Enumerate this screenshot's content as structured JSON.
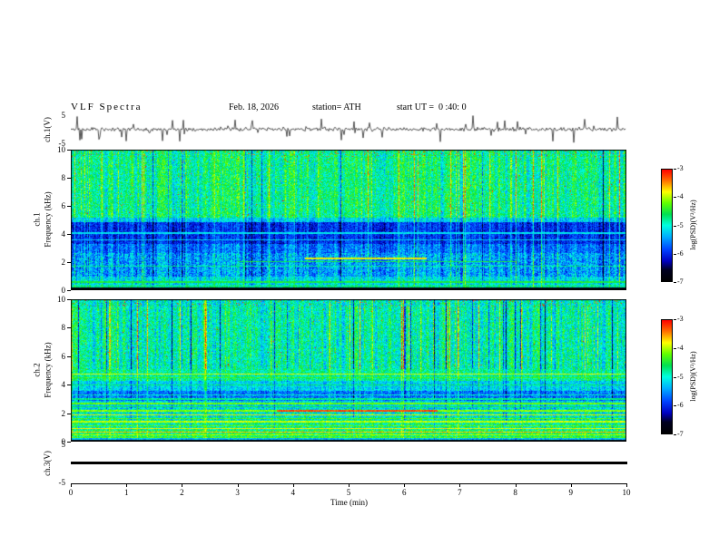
{
  "header": {
    "title": "VLF Spectra",
    "date": "Feb. 18, 2026",
    "station": "station= ATH",
    "start_ut": "start UT =  0 :40: 0"
  },
  "axes": {
    "x": {
      "label": "Time (min)",
      "range": [
        0,
        10
      ],
      "ticks": [
        0,
        1,
        2,
        3,
        4,
        5,
        6,
        7,
        8,
        9,
        10
      ]
    },
    "wave_y": {
      "units": "V",
      "range": [
        -5,
        5
      ],
      "ticks": [
        5,
        -5
      ]
    },
    "spec_y": {
      "label": "Frequency (kHz)",
      "range": [
        0,
        10
      ],
      "ticks": [
        10,
        8,
        6,
        4,
        2,
        0
      ]
    },
    "colorbar": {
      "label": "log(PSD)(V²/Hz)",
      "range": [
        -7,
        -3
      ],
      "ticks": [
        -3,
        -4,
        -5,
        -6,
        -7
      ]
    }
  },
  "panels": {
    "ch1_wave": {
      "label": "ch.1(V)"
    },
    "ch1_spec": {
      "line1": "ch.1",
      "line2": "Frequency (kHz)"
    },
    "ch2_spec": {
      "line1": "ch.2",
      "line2": "Frequency (kHz)"
    },
    "ch3_wave": {
      "label": "ch.3(V)"
    }
  },
  "colormap": [
    [
      0,
      "#000000"
    ],
    [
      0.1,
      "#000020"
    ],
    [
      0.18,
      "#0000c0"
    ],
    [
      0.28,
      "#0040ff"
    ],
    [
      0.4,
      "#00b0ff"
    ],
    [
      0.5,
      "#00ffe0"
    ],
    [
      0.6,
      "#00e050"
    ],
    [
      0.7,
      "#60ff00"
    ],
    [
      0.8,
      "#ffff00"
    ],
    [
      0.9,
      "#ff7000"
    ],
    [
      1,
      "#ff0000"
    ]
  ],
  "chart_data": [
    {
      "type": "line",
      "name": "ch1-voltage-time-series",
      "ylabel": "ch.1(V)",
      "ylim": [
        -5,
        5
      ],
      "xlim": [
        0,
        10
      ],
      "xlabel": "Time (min)",
      "description": "Channel-1 VLF receiver voltage vs time: continuous low-amplitude noise around 0 V punctuated by frequent impulsive sferic spikes reaching toward ±5 V across the full 10-minute record.",
      "render": {
        "seed": 11,
        "sigma": 0.3,
        "spike_prob": 0.08,
        "spike_extra": 3.6
      }
    },
    {
      "type": "heatmap",
      "name": "ch1-spectrogram",
      "ylabel": "Frequency (kHz)",
      "ylim": [
        0,
        10
      ],
      "xlim": [
        0,
        10
      ],
      "zlabel": "log(PSD)(V²/Hz)",
      "zlim": [
        -7,
        -3
      ],
      "description": "Channel-1 dynamic spectrum 0-10 kHz over 10 min: green/cyan broadband power above ~5 kHz with dense vertical sferic striations (occasional yellow/red flecks, red speckle along the top edge), a dark-blue low-power band ~3.3-4.9 kHz, mottled blue-cyan 1-2.7 kHz with an orange streak near 2.3 kHz around minutes 4-6.5, and a black (below -7) band under ~0.2 kHz.",
      "render": {
        "seed": 22,
        "fmax": 10,
        "bands": [
          {
            "f": [
              9.5,
              10.01
            ],
            "v": 0.55,
            "s": 0.55,
            "n": 0.25,
            "hot": 0.05
          },
          {
            "f": [
              5.2,
              9.5
            ],
            "v": 0.56,
            "s": 0.6,
            "n": 0.24,
            "hot": 0.004
          },
          {
            "f": [
              4.9,
              5.2
            ],
            "v": 0.44,
            "s": 0.5,
            "n": 0.2
          },
          {
            "f": [
              3.3,
              4.9
            ],
            "v": 0.25,
            "s": 0.45,
            "n": 0.18
          },
          {
            "f": [
              2.7,
              3.3
            ],
            "v": 0.33,
            "s": 0.5,
            "n": 0.2
          },
          {
            "f": [
              1.0,
              2.7
            ],
            "v": 0.38,
            "s": 0.55,
            "n": 0.26
          },
          {
            "f": [
              0.4,
              1.0
            ],
            "v": 0.46,
            "s": 0.45,
            "n": 0.22
          },
          {
            "f": [
              0.22,
              0.4
            ],
            "v": 0.52,
            "s": 0.3,
            "n": 0.2
          },
          {
            "f": [
              0,
              0.22
            ],
            "v": 0.03,
            "s": 0.05,
            "n": 0.04
          }
        ],
        "lines": [
          {
            "f": 4.1,
            "hw": 0.05,
            "v": 0.46,
            "x0": 0,
            "x1": 1
          },
          {
            "f": 3.6,
            "hw": 0.04,
            "v": 0.44,
            "x0": 0,
            "x1": 1
          },
          {
            "f": 2.3,
            "hw": 0.07,
            "v": 0.8,
            "x0": 0.42,
            "x1": 0.64
          },
          {
            "f": 2.05,
            "hw": 0.05,
            "v": 0.62,
            "x0": 0.3,
            "x1": 0.8
          },
          {
            "f": 1.75,
            "hw": 0.04,
            "v": 0.55,
            "x0": 0,
            "x1": 1
          },
          {
            "f": 0.6,
            "hw": 0.05,
            "v": 0.62,
            "x0": 0,
            "x1": 1
          },
          {
            "f": 0.33,
            "hw": 0.04,
            "v": 0.58,
            "x0": 0,
            "x1": 1
          }
        ]
      }
    },
    {
      "type": "heatmap",
      "name": "ch2-spectrogram",
      "ylabel": "Frequency (kHz)",
      "ylim": [
        0,
        10
      ],
      "xlim": [
        0,
        10
      ],
      "zlabel": "log(PSD)(V²/Hz)",
      "zlim": [
        -7,
        -3
      ],
      "description": "Channel-2 dynamic spectrum 0-10 kHz: green/cyan broadband power with vertical sferic striations above ~5 kHz, and a stack of quasi-horizontal harmonic lines below ~5 kHz (yellow line near 4.8 kHz, darker blue zone 2.9-3.6 kHz, many bright green/yellow/orange lines 0.3-2.7 kHz including an intense red streak near 2.2 kHz around minutes 4-6.5) with a black band below ~0.15 kHz.",
      "render": {
        "seed": 33,
        "fmax": 10,
        "bands": [
          {
            "f": [
              9.5,
              10.01
            ],
            "v": 0.5,
            "s": 0.5,
            "n": 0.26,
            "hot": 0.03
          },
          {
            "f": [
              5.1,
              9.5
            ],
            "v": 0.52,
            "s": 0.65,
            "n": 0.24,
            "hot": 0.003
          },
          {
            "f": [
              4.3,
              5.1
            ],
            "v": 0.55,
            "s": 0.35,
            "n": 0.2
          },
          {
            "f": [
              3.6,
              4.3
            ],
            "v": 0.44,
            "s": 0.35,
            "n": 0.2
          },
          {
            "f": [
              2.9,
              3.6
            ],
            "v": 0.33,
            "s": 0.3,
            "n": 0.2
          },
          {
            "f": [
              2.35,
              2.9
            ],
            "v": 0.45,
            "s": 0.3,
            "n": 0.24
          },
          {
            "f": [
              1.55,
              2.35
            ],
            "v": 0.5,
            "s": 0.3,
            "n": 0.28
          },
          {
            "f": [
              0.85,
              1.55
            ],
            "v": 0.55,
            "s": 0.25,
            "n": 0.26
          },
          {
            "f": [
              0.28,
              0.85
            ],
            "v": 0.6,
            "s": 0.2,
            "n": 0.24
          },
          {
            "f": [
              0.14,
              0.28
            ],
            "v": 0.42,
            "s": 0.1,
            "n": 0.15
          },
          {
            "f": [
              0,
              0.14
            ],
            "v": 0.04,
            "s": 0.05,
            "n": 0.05
          }
        ],
        "lines": [
          {
            "f": 4.78,
            "hw": 0.06,
            "v": 0.78,
            "x0": 0,
            "x1": 1
          },
          {
            "f": 4.5,
            "hw": 0.04,
            "v": 0.66,
            "x0": 0,
            "x1": 1
          },
          {
            "f": 4.02,
            "hw": 0.04,
            "v": 0.58,
            "x0": 0,
            "x1": 1
          },
          {
            "f": 3.3,
            "hw": 0.04,
            "v": 0.52,
            "x0": 0,
            "x1": 1
          },
          {
            "f": 3.02,
            "hw": 0.04,
            "v": 0.56,
            "x0": 0,
            "x1": 1
          },
          {
            "f": 2.72,
            "hw": 0.05,
            "v": 0.7,
            "x0": 0,
            "x1": 1
          },
          {
            "f": 2.48,
            "hw": 0.04,
            "v": 0.62,
            "x0": 0,
            "x1": 1
          },
          {
            "f": 2.18,
            "hw": 0.05,
            "v": 0.72,
            "x0": 0,
            "x1": 1
          },
          {
            "f": 2.2,
            "hw": 0.08,
            "v": 0.93,
            "x0": 0.37,
            "x1": 0.66
          },
          {
            "f": 1.92,
            "hw": 0.05,
            "v": 0.8,
            "x0": 0,
            "x1": 1
          },
          {
            "f": 1.66,
            "hw": 0.04,
            "v": 0.68,
            "x0": 0,
            "x1": 1
          },
          {
            "f": 1.42,
            "hw": 0.05,
            "v": 0.76,
            "x0": 0,
            "x1": 1
          },
          {
            "f": 1.16,
            "hw": 0.04,
            "v": 0.7,
            "x0": 0,
            "x1": 1
          },
          {
            "f": 0.94,
            "hw": 0.04,
            "v": 0.8,
            "x0": 0,
            "x1": 1
          },
          {
            "f": 0.7,
            "hw": 0.05,
            "v": 0.85,
            "x0": 0,
            "x1": 1
          },
          {
            "f": 0.5,
            "hw": 0.04,
            "v": 0.74,
            "x0": 0,
            "x1": 1
          },
          {
            "f": 0.33,
            "hw": 0.04,
            "v": 0.68,
            "x0": 0,
            "x1": 1
          }
        ]
      }
    },
    {
      "type": "line",
      "name": "ch3-voltage-time-series",
      "ylabel": "ch.3(V)",
      "ylim": [
        -5,
        5
      ],
      "xlim": [
        0,
        10
      ],
      "description": "Channel-3 voltage: flat constant line at ~0 V for the entire 10-minute record (channel inactive).",
      "render": {
        "flat": 0
      }
    }
  ]
}
